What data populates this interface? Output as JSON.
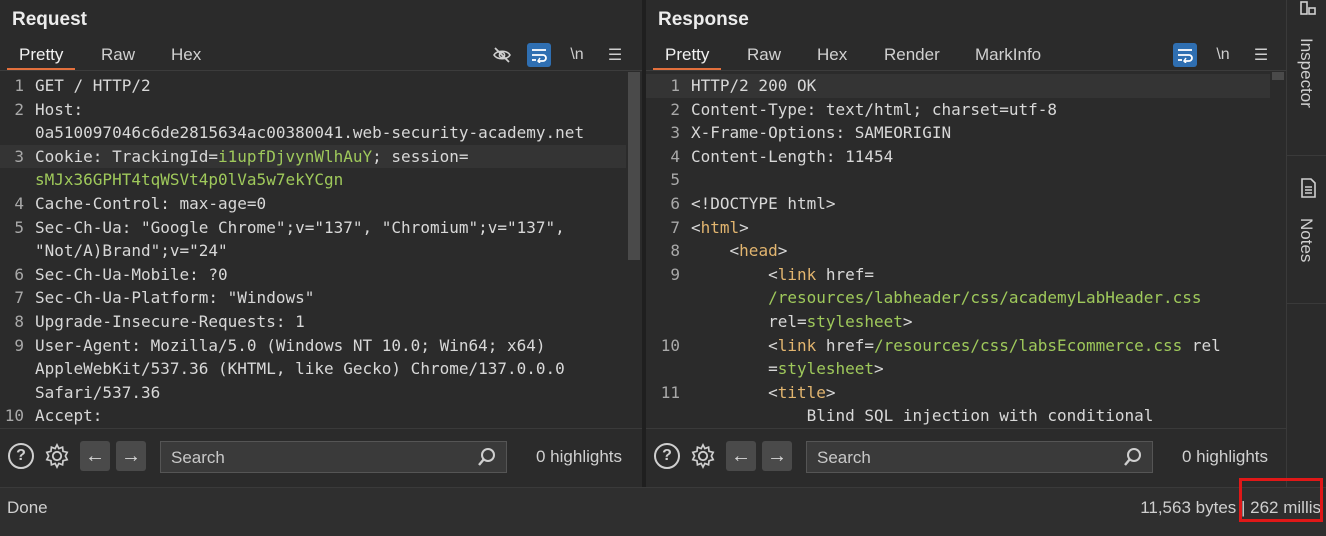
{
  "request": {
    "title": "Request",
    "tabs": [
      "Pretty",
      "Raw",
      "Hex"
    ],
    "active_tab": "Pretty",
    "lines": [
      {
        "n": "1",
        "text": "GET / HTTP/2"
      },
      {
        "n": "2",
        "text": "Host:"
      },
      {
        "n": "",
        "text": "0a510097046c6de2815634ac00380041.web-security-academy.net"
      },
      {
        "n": "3",
        "key": "Cookie: TrackingId=",
        "value": "i1upfDjvynWlhAuY",
        "rest": "; session=",
        "highlighted": true
      },
      {
        "n": "",
        "value": "sMJx36GPHT4tqWSVt4p0lVa5w7ekYCgn"
      },
      {
        "n": "4",
        "text": "Cache-Control: max-age=0"
      },
      {
        "n": "5",
        "text": "Sec-Ch-Ua: \"Google Chrome\";v=\"137\", \"Chromium\";v=\"137\","
      },
      {
        "n": "",
        "text": "\"Not/A)Brand\";v=\"24\""
      },
      {
        "n": "6",
        "text": "Sec-Ch-Ua-Mobile: ?0"
      },
      {
        "n": "7",
        "text": "Sec-Ch-Ua-Platform: \"Windows\""
      },
      {
        "n": "8",
        "text": "Upgrade-Insecure-Requests: 1"
      },
      {
        "n": "9",
        "text": "User-Agent: Mozilla/5.0 (Windows NT 10.0; Win64; x64)"
      },
      {
        "n": "",
        "text": "AppleWebKit/537.36 (KHTML, like Gecko) Chrome/137.0.0.0"
      },
      {
        "n": "",
        "text": "Safari/537.36"
      },
      {
        "n": "10",
        "text": "Accept:"
      }
    ],
    "search_placeholder": "Search",
    "highlights": "0 highlights"
  },
  "response": {
    "title": "Response",
    "tabs": [
      "Pretty",
      "Raw",
      "Hex",
      "Render",
      "MarkInfo"
    ],
    "active_tab": "Pretty",
    "lines": [
      {
        "n": "1",
        "segs": [
          [
            "k",
            "HTTP/2 200 OK"
          ]
        ],
        "highlighted": true
      },
      {
        "n": "2",
        "segs": [
          [
            "k",
            "Content-Type: text/html; charset=utf-8"
          ]
        ]
      },
      {
        "n": "3",
        "segs": [
          [
            "k",
            "X-Frame-Options: SAMEORIGIN"
          ]
        ]
      },
      {
        "n": "4",
        "segs": [
          [
            "k",
            "Content-Length: 11454"
          ]
        ]
      },
      {
        "n": "5",
        "segs": []
      },
      {
        "n": "6",
        "segs": [
          [
            "k",
            "<!DOCTYPE html>"
          ]
        ]
      },
      {
        "n": "7",
        "segs": [
          [
            "k",
            "<"
          ],
          [
            "tg",
            "html"
          ],
          [
            "k",
            ">"
          ]
        ]
      },
      {
        "n": "8",
        "segs": [
          [
            "k",
            "    <"
          ],
          [
            "tg",
            "head"
          ],
          [
            "k",
            ">"
          ]
        ]
      },
      {
        "n": "9",
        "segs": [
          [
            "k",
            "        <"
          ],
          [
            "tg",
            "link"
          ],
          [
            "k",
            " href="
          ]
        ]
      },
      {
        "n": "",
        "segs": [
          [
            "v",
            "        /resources/labheader/css/academyLabHeader.css"
          ]
        ]
      },
      {
        "n": "",
        "segs": [
          [
            "k",
            "        rel="
          ],
          [
            "v",
            "stylesheet"
          ],
          [
            "k",
            ">"
          ]
        ]
      },
      {
        "n": "10",
        "segs": [
          [
            "k",
            "        <"
          ],
          [
            "tg",
            "link"
          ],
          [
            "k",
            " href="
          ],
          [
            "v",
            "/resources/css/labsEcommerce.css"
          ],
          [
            "k",
            " rel"
          ]
        ]
      },
      {
        "n": "",
        "segs": [
          [
            "k",
            "        ="
          ],
          [
            "v",
            "stylesheet"
          ],
          [
            "k",
            ">"
          ]
        ]
      },
      {
        "n": "11",
        "segs": [
          [
            "k",
            "        <"
          ],
          [
            "tg",
            "title"
          ],
          [
            "k",
            ">"
          ]
        ]
      },
      {
        "n": "",
        "segs": [
          [
            "k",
            "            Blind SQL injection with conditional"
          ]
        ]
      }
    ],
    "search_placeholder": "Search",
    "highlights": "0 highlights"
  },
  "toolbar_icons": {
    "hide": "eye-off-icon",
    "wrap": "word-wrap-icon",
    "newline": "\\n",
    "menu": "☰"
  },
  "sidebar": {
    "inspector": "Inspector",
    "notes": "Notes"
  },
  "status": {
    "left": "Done",
    "right": "11,563 bytes | 262 millis"
  },
  "colors": {
    "accent": "#e3703d",
    "blue": "#2f6fb2",
    "value_green": "#9fc95b",
    "tag_orange": "#e2b56f",
    "highlight_box": "#e01818"
  }
}
